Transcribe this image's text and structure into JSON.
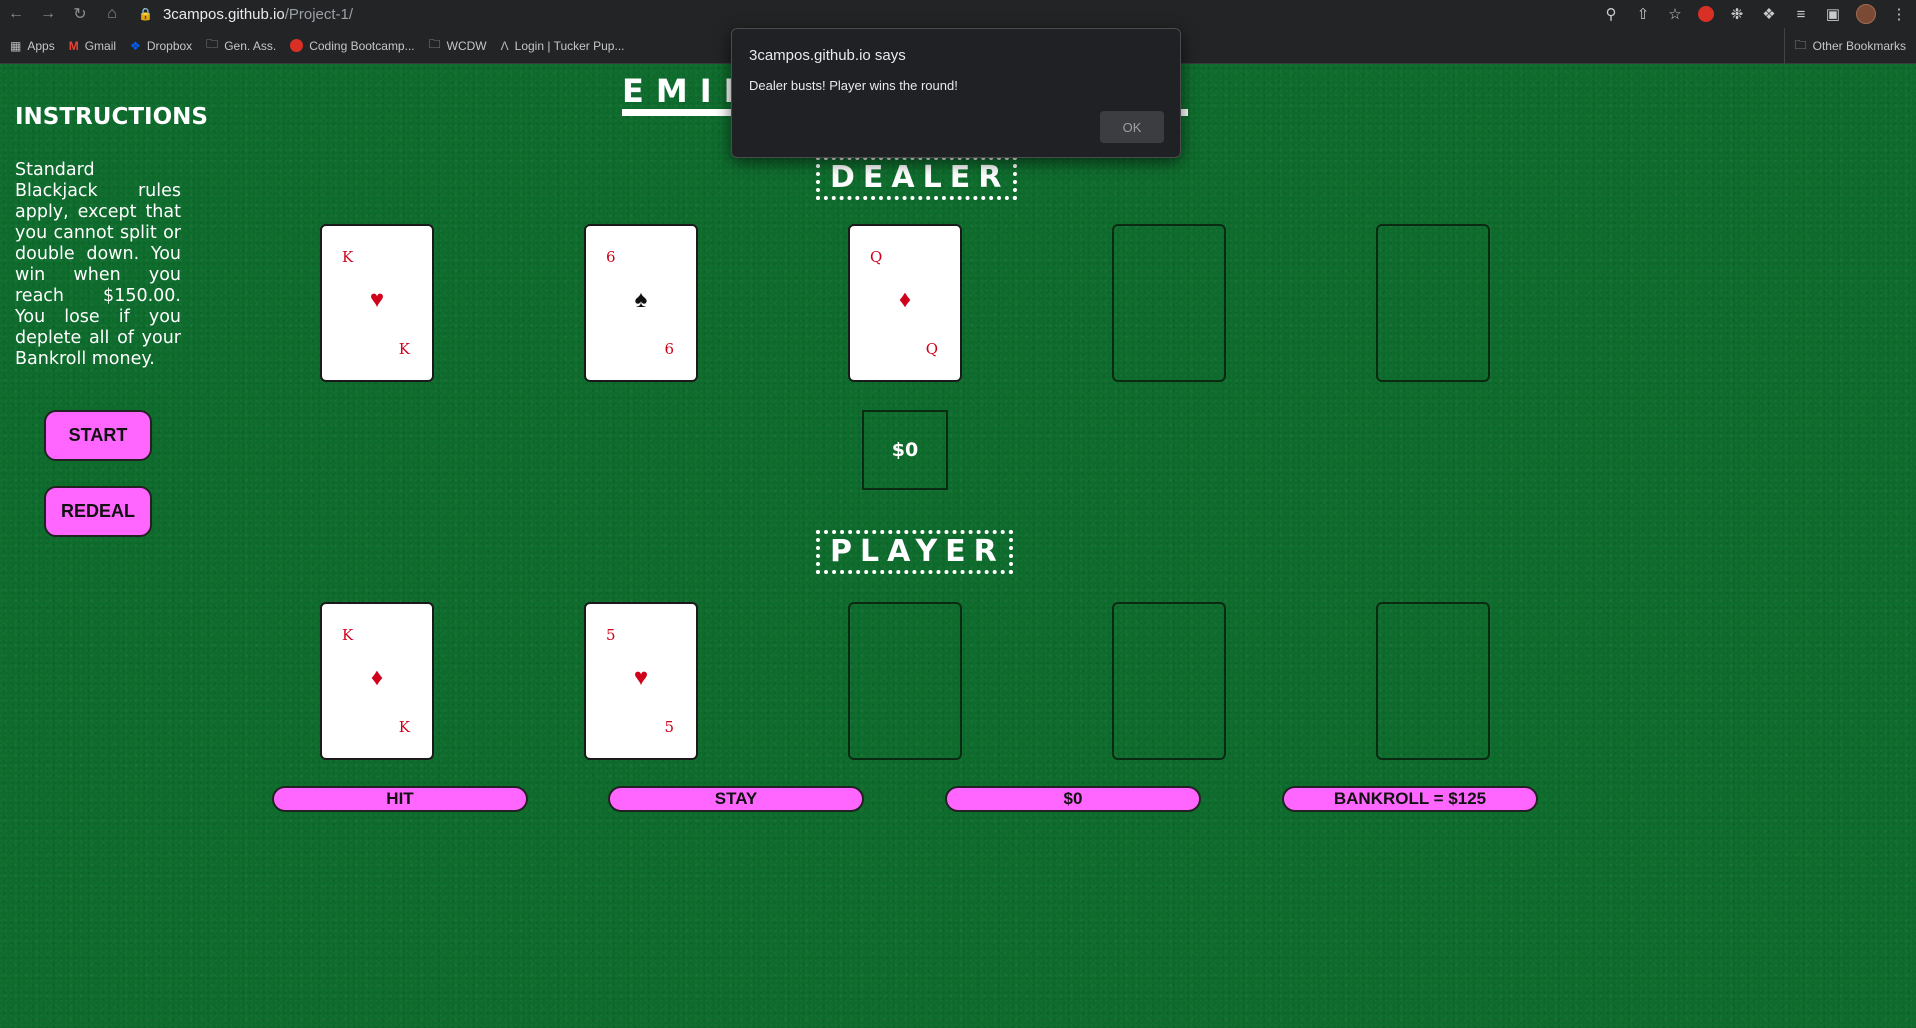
{
  "browser": {
    "url_host": "3campos.github.io",
    "url_path": "/Project-1/",
    "bookmarks": [
      {
        "label": "Apps",
        "icon": "apps-grid-icon"
      },
      {
        "label": "Gmail",
        "icon": "gmail-icon"
      },
      {
        "label": "Dropbox",
        "icon": "dropbox-icon"
      },
      {
        "label": "Gen. Ass.",
        "icon": "folder-icon"
      },
      {
        "label": "Coding Bootcamp...",
        "icon": "bootcamp-icon"
      },
      {
        "label": "WCDW",
        "icon": "folder-icon"
      },
      {
        "label": "Login | Tucker Pup...",
        "icon": "site-icon"
      }
    ],
    "other_bookmarks": "Other Bookmarks"
  },
  "sidebar": {
    "title": "INSTRUCTIONS",
    "text": "Standard Blackjack rules apply, except that you cannot split or double down. You win when you reach $150.00. You lose if you deplete all of your Bankroll money.",
    "start_label": "START",
    "redeal_label": "REDEAL"
  },
  "game": {
    "title_visible": "EMIL",
    "dealer_label": "DEALER",
    "player_label": "PLAYER",
    "pot": "$0",
    "dealer_cards": [
      {
        "rank": "K",
        "suit": "♥",
        "color": "red"
      },
      {
        "rank": "6",
        "suit": "♠",
        "color": "black"
      },
      {
        "rank": "Q",
        "suit": "♦",
        "color": "red"
      }
    ],
    "player_cards": [
      {
        "rank": "K",
        "suit": "♦",
        "color": "red"
      },
      {
        "rank": "5",
        "suit": "♥",
        "color": "red"
      }
    ],
    "controls": {
      "hit": "HIT",
      "stay": "STAY",
      "bet": "$0",
      "bankroll": "BANKROLL = $125"
    }
  },
  "dialog": {
    "title": "3campos.github.io says",
    "message": "Dealer busts! Player wins the round!",
    "ok_label": "OK"
  },
  "colors": {
    "felt": "#0d6b2c",
    "button_pink": "#ff66ff",
    "card_red": "#d0021b"
  }
}
